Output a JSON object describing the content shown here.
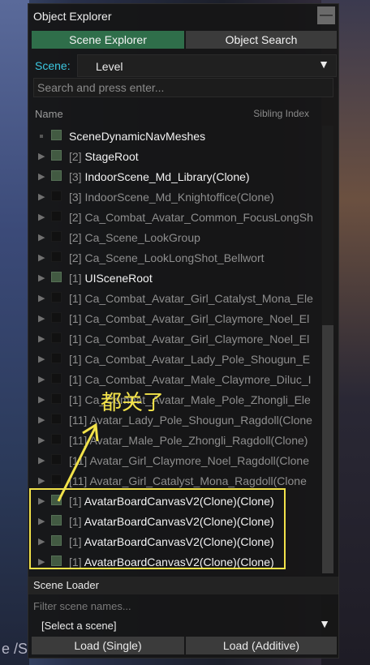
{
  "window": {
    "title": "Object Explorer",
    "minimize_label": "—"
  },
  "tabs": [
    {
      "label": "Scene Explorer",
      "active": true
    },
    {
      "label": "Object Search",
      "active": false
    }
  ],
  "scene": {
    "label": "Scene:",
    "value": "Level",
    "arrow": "▼"
  },
  "search": {
    "placeholder": "Search and press enter..."
  },
  "columns": {
    "name": "Name",
    "sibling_index": "Sibling Index"
  },
  "tree_rows": [
    {
      "text": "SceneDynamicNavMeshes",
      "expandable": false,
      "checked": true,
      "bright": true
    },
    {
      "prefix": "[2]",
      "text": "StageRoot",
      "expandable": true,
      "checked": true,
      "bright": true
    },
    {
      "prefix": "[3]",
      "text": "IndoorScene_Md_Library(Clone)",
      "expandable": true,
      "checked": true,
      "bright": true
    },
    {
      "prefix": "[3]",
      "text": "IndoorScene_Md_Knightoffice(Clone)",
      "expandable": true,
      "checked": false,
      "bright": false
    },
    {
      "prefix": "[2]",
      "text": "Ca_Combat_Avatar_Common_FocusLongSh",
      "expandable": true,
      "checked": false,
      "bright": false
    },
    {
      "prefix": "[2]",
      "text": "Ca_Scene_LookGroup",
      "expandable": true,
      "checked": false,
      "bright": false
    },
    {
      "prefix": "[2]",
      "text": "Ca_Scene_LookLongShot_Bellwort",
      "expandable": true,
      "checked": false,
      "bright": false
    },
    {
      "prefix": "[1]",
      "text": "UISceneRoot",
      "expandable": true,
      "checked": true,
      "bright": true
    },
    {
      "prefix": "[1]",
      "text": "Ca_Combat_Avatar_Girl_Catalyst_Mona_Ele",
      "expandable": true,
      "checked": false,
      "bright": false
    },
    {
      "prefix": "[1]",
      "text": "Ca_Combat_Avatar_Girl_Claymore_Noel_El",
      "expandable": true,
      "checked": false,
      "bright": false
    },
    {
      "prefix": "[1]",
      "text": "Ca_Combat_Avatar_Girl_Claymore_Noel_El",
      "expandable": true,
      "checked": false,
      "bright": false
    },
    {
      "prefix": "[1]",
      "text": "Ca_Combat_Avatar_Lady_Pole_Shougun_E",
      "expandable": true,
      "checked": false,
      "bright": false
    },
    {
      "prefix": "[1]",
      "text": "Ca_Combat_Avatar_Male_Claymore_Diluc_I",
      "expandable": true,
      "checked": false,
      "bright": false
    },
    {
      "prefix": "[1]",
      "text": "Ca_Combat_Avatar_Male_Pole_Zhongli_Ele",
      "expandable": true,
      "checked": false,
      "bright": false
    },
    {
      "prefix": "[11]",
      "text": "Avatar_Lady_Pole_Shougun_Ragdoll(Clone",
      "expandable": true,
      "checked": false,
      "bright": false
    },
    {
      "prefix": "[11]",
      "text": "Avatar_Male_Pole_Zhongli_Ragdoll(Clone)",
      "expandable": true,
      "checked": false,
      "bright": false
    },
    {
      "prefix": "[11]",
      "text": "Avatar_Girl_Claymore_Noel_Ragdoll(Clone",
      "expandable": true,
      "checked": false,
      "bright": false
    },
    {
      "prefix": "[11]",
      "text": "Avatar_Girl_Catalyst_Mona_Ragdoll(Clone",
      "expandable": true,
      "checked": false,
      "bright": false
    },
    {
      "prefix": "[1]",
      "text": "AvatarBoardCanvasV2(Clone)(Clone)",
      "expandable": true,
      "checked": true,
      "bright": true
    },
    {
      "prefix": "[1]",
      "text": "AvatarBoardCanvasV2(Clone)(Clone)",
      "expandable": true,
      "checked": true,
      "bright": true
    },
    {
      "prefix": "[1]",
      "text": "AvatarBoardCanvasV2(Clone)(Clone)",
      "expandable": true,
      "checked": true,
      "bright": true
    },
    {
      "prefix": "[1]",
      "text": "AvatarBoardCanvasV2(Clone)(Clone)",
      "expandable": true,
      "checked": true,
      "bright": true
    }
  ],
  "scene_loader": {
    "title": "Scene Loader",
    "filter_placeholder": "Filter scene names...",
    "select_value": "[Select a scene]",
    "select_arrow": "▼",
    "load_single": "Load (Single)",
    "load_additive": "Load (Additive)"
  },
  "annotation": {
    "text": "都关了",
    "color": "#f2e24a"
  },
  "background_text": "e /S",
  "colors": {
    "active_tab": "#2f6e4a",
    "scene_label": "#3cc7e0",
    "highlight": "#f2e24a"
  }
}
